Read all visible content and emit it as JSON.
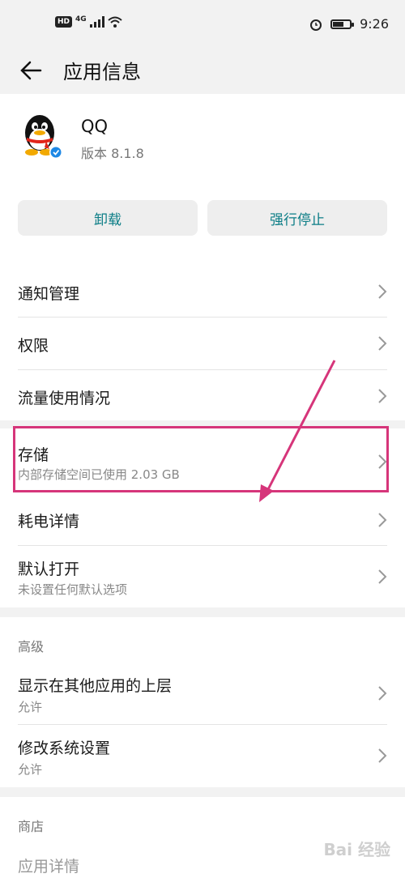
{
  "status_bar": {
    "hd": "HD",
    "network": "4G",
    "time": "9:26",
    "battery_level": 0.7
  },
  "header": {
    "title": "应用信息"
  },
  "app": {
    "name": "QQ",
    "version": "版本 8.1.8"
  },
  "buttons": {
    "uninstall": "卸载",
    "force_stop": "强行停止"
  },
  "items": {
    "notifications": "通知管理",
    "permissions": "权限",
    "data_usage": "流量使用情况",
    "storage": "存储",
    "storage_sub": "内部存储空间已使用 2.03 GB",
    "power": "耗电详情",
    "default_open": "默认打开",
    "default_open_sub": "未设置任何默认选项"
  },
  "advanced": {
    "heading": "高级",
    "overlay": "显示在其他应用的上层",
    "overlay_sub": "允许",
    "modify_settings": "修改系统设置",
    "modify_settings_sub": "允许"
  },
  "store": {
    "heading": "商店",
    "app_details": "应用详情"
  },
  "watermark": "Bai 经验",
  "colors": {
    "accent": "#0b7d86",
    "highlight": "#d6357a",
    "background_gray": "#f2f2f2"
  }
}
